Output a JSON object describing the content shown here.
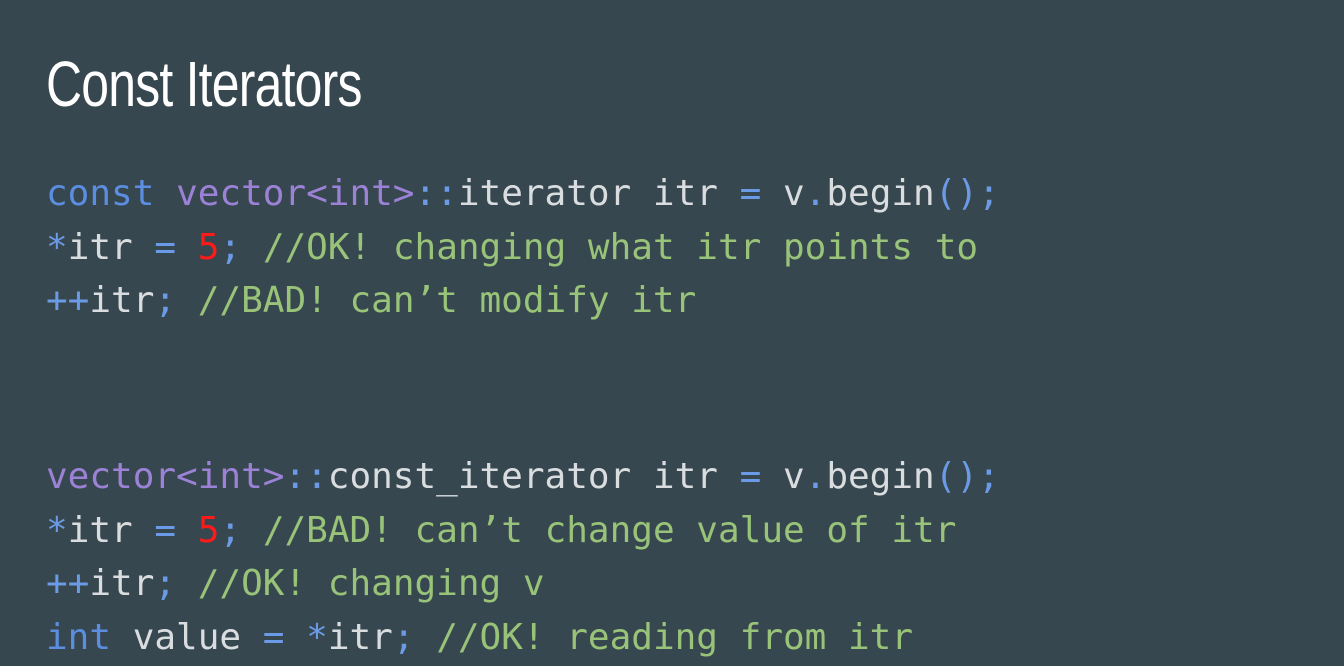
{
  "slide": {
    "title": "Const Iterators",
    "code_blocks": [
      {
        "lines": [
          [
            {
              "text": "const",
              "kind": "kw"
            },
            {
              "text": " ",
              "kind": "id"
            },
            {
              "text": "vector<int>",
              "kind": "type"
            },
            {
              "text": "::",
              "kind": "op"
            },
            {
              "text": "iterator itr ",
              "kind": "id"
            },
            {
              "text": "=",
              "kind": "op"
            },
            {
              "text": " v",
              "kind": "id"
            },
            {
              "text": ".",
              "kind": "op"
            },
            {
              "text": "begin",
              "kind": "id"
            },
            {
              "text": "();",
              "kind": "op"
            }
          ],
          [
            {
              "text": "*",
              "kind": "op"
            },
            {
              "text": "itr ",
              "kind": "id"
            },
            {
              "text": "=",
              "kind": "op"
            },
            {
              "text": " ",
              "kind": "id"
            },
            {
              "text": "5",
              "kind": "num"
            },
            {
              "text": ";",
              "kind": "op"
            },
            {
              "text": " //OK! changing what itr points to",
              "kind": "cm"
            }
          ],
          [
            {
              "text": "++",
              "kind": "op"
            },
            {
              "text": "itr",
              "kind": "id"
            },
            {
              "text": ";",
              "kind": "op"
            },
            {
              "text": " //BAD! can’t modify itr",
              "kind": "cm"
            }
          ]
        ]
      },
      {
        "lines": [
          [
            {
              "text": "vector<int>",
              "kind": "type"
            },
            {
              "text": "::",
              "kind": "op"
            },
            {
              "text": "const_iterator itr ",
              "kind": "id"
            },
            {
              "text": "=",
              "kind": "op"
            },
            {
              "text": " v",
              "kind": "id"
            },
            {
              "text": ".",
              "kind": "op"
            },
            {
              "text": "begin",
              "kind": "id"
            },
            {
              "text": "();",
              "kind": "op"
            }
          ],
          [
            {
              "text": "*",
              "kind": "op"
            },
            {
              "text": "itr ",
              "kind": "id"
            },
            {
              "text": "=",
              "kind": "op"
            },
            {
              "text": " ",
              "kind": "id"
            },
            {
              "text": "5",
              "kind": "num"
            },
            {
              "text": ";",
              "kind": "op"
            },
            {
              "text": " //BAD! can’t change value of itr",
              "kind": "cm"
            }
          ],
          [
            {
              "text": "++",
              "kind": "op"
            },
            {
              "text": "itr",
              "kind": "id"
            },
            {
              "text": ";",
              "kind": "op"
            },
            {
              "text": " //OK! changing v",
              "kind": "cm"
            }
          ],
          [
            {
              "text": "int",
              "kind": "kw"
            },
            {
              "text": " value ",
              "kind": "id"
            },
            {
              "text": "=",
              "kind": "op"
            },
            {
              "text": " ",
              "kind": "id"
            },
            {
              "text": "*",
              "kind": "op"
            },
            {
              "text": "itr",
              "kind": "id"
            },
            {
              "text": ";",
              "kind": "op"
            },
            {
              "text": " //OK! reading from itr",
              "kind": "cm"
            }
          ]
        ]
      }
    ]
  },
  "colors": {
    "background": "#37474f",
    "title": "#ffffff",
    "keyword": "#5b8de0",
    "type": "#9c82d6",
    "operator": "#6b9ae6",
    "identifier": "#d9dde0",
    "number": "#ff1a1a",
    "comment": "#98c379"
  }
}
